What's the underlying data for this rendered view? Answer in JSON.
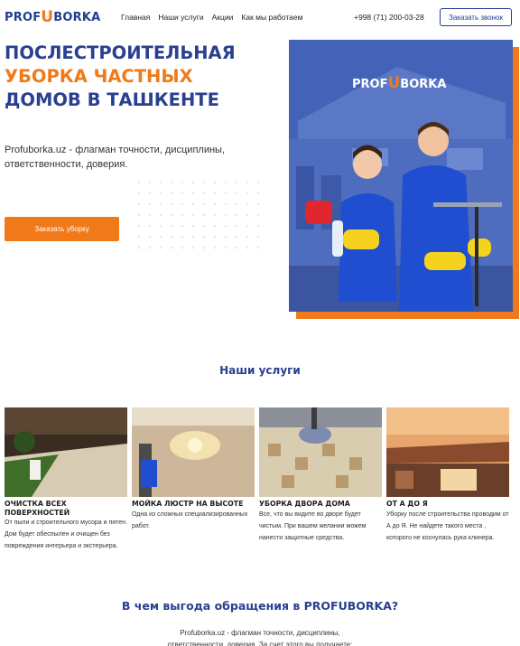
{
  "header": {
    "logo_prefix": "PROF",
    "logo_u": "U",
    "logo_suffix": "BORKA",
    "nav": [
      "Главная",
      "Наши услуги",
      "Акции",
      "Как мы работаем"
    ],
    "phone": "+998 (71) 200-03-28",
    "call_button": "Заказать звонок"
  },
  "hero": {
    "title_line1": "ПОСЛЕСТРОИТЕЛЬНАЯ",
    "title_line2": "УБОРКА ЧАСТНЫХ",
    "title_line3": "ДОМОВ В ТАШКЕНТЕ",
    "subtitle": "Profuborka.uz - флагман точности, дисциплины, ответственности, доверия.",
    "order_button": "Заказать уборку",
    "image_logo_prefix": "PROF",
    "image_logo_u": "U",
    "image_logo_suffix": "BORKA"
  },
  "services": {
    "title": "Наши услуги",
    "cards": [
      {
        "title": "ОЧИСТКА ВСЕХ ПОВЕРХНОСТЕЙ",
        "desc": "От пыли и строительного мусора и пятен. Дом будет обеспылен и очищен без повреждения интерьера и экстерьера."
      },
      {
        "title": "МОЙКА ЛЮСТР НА ВЫСОТЕ",
        "desc": "Одна из сложных специализированных работ."
      },
      {
        "title": "УБОРКА ДВОРА ДОМА",
        "desc": "Все, что вы видите во дворе будет чистым. При вашем желании можем нанести защитные средства."
      },
      {
        "title": "ОТ А ДО Я",
        "desc": "Уборку после строительства проводим от А до Я. Не найдете такого места , которого не коснулась рука клинера."
      }
    ]
  },
  "benefits": {
    "title": "В чем выгода обращения в PROFUBORKA?",
    "text_line1": "Profuborka.uz - флагман точности, дисциплины,",
    "text_line2": "ответственности, доверия. За счет этого вы получаете:"
  },
  "colors": {
    "brand_blue": "#2a3f8f",
    "accent_orange": "#f07a1a"
  }
}
